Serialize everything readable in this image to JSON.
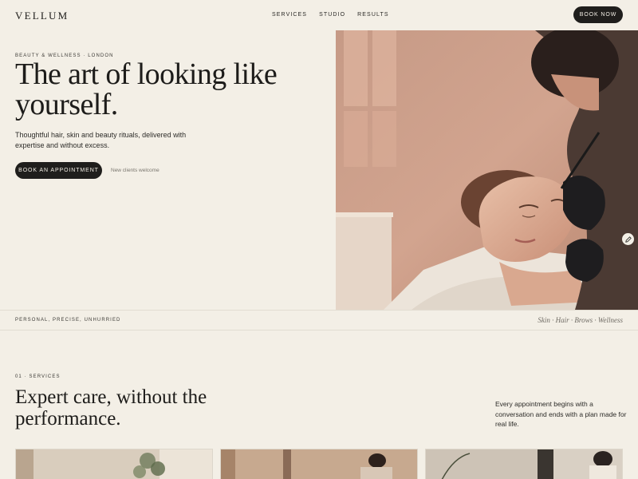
{
  "header": {
    "brand": "VELLUM",
    "nav": [
      "SERVICES",
      "STUDIO",
      "RESULTS"
    ],
    "book_now": "BOOK NOW"
  },
  "hero": {
    "eyebrow": "BEAUTY & WELLNESS · LONDON",
    "title": "The art of looking like yourself.",
    "subtitle": "Thoughtful hair, skin and beauty rituals, delivered with expertise and without excess.",
    "cta": "BOOK AN APPOINTMENT",
    "cta_note": "New clients welcome",
    "image_icon": "brow-treatment-photo"
  },
  "strip": {
    "left": "PERSONAL, PRECISE, UNHURRIED",
    "right": "Skin · Hair · Brows · Wellness"
  },
  "services": {
    "label": "01 · SERVICES",
    "title": "Expert care, without the performance.",
    "note": "Every appointment begins with a conversation and ends with a plan made for real life."
  },
  "colors": {
    "background": "#f3efe6",
    "ink": "#1d1c1a",
    "button": "#1f1e1c",
    "muted": "#7a766f"
  }
}
